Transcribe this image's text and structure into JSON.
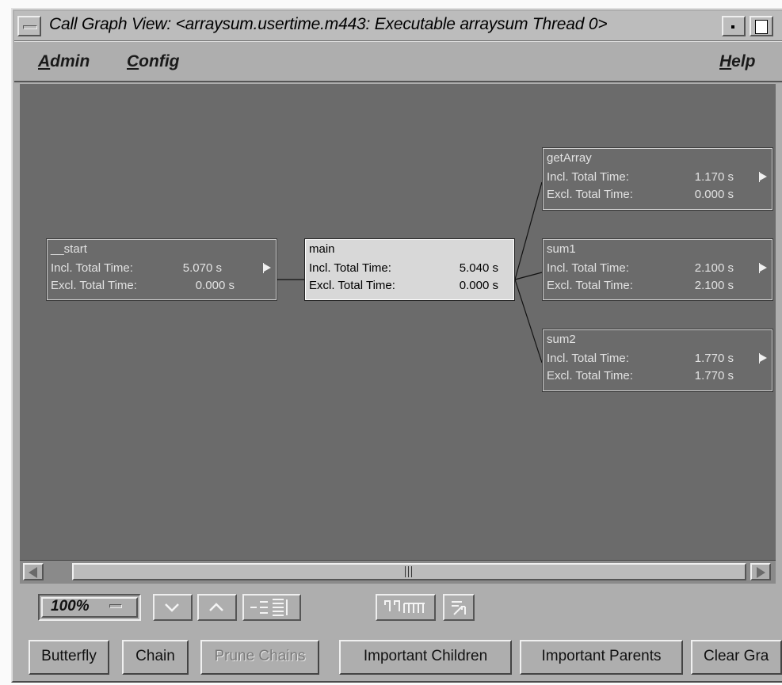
{
  "window": {
    "title": "Call Graph View: <arraysum.usertime.m443: Executable arraysum Thread 0>"
  },
  "menubar": {
    "admin": "Admin",
    "admin_mnemonic": "A",
    "admin_rest": "dmin",
    "config": "Config",
    "config_mnemonic": "C",
    "config_rest": "onfig",
    "help": "Help",
    "help_mnemonic": "H",
    "help_rest": "elp"
  },
  "graph": {
    "incl_label": "Incl. Total Time:",
    "excl_label": "Excl. Total Time:",
    "nodes": [
      {
        "name": "__start",
        "incl": "5.070 s",
        "excl": "0.000 s",
        "selected": false,
        "has_flag": true
      },
      {
        "name": "main",
        "incl": "5.040 s",
        "excl": "0.000 s",
        "selected": true,
        "has_flag": false
      },
      {
        "name": "getArray",
        "incl": "1.170 s",
        "excl": "0.000 s",
        "selected": false,
        "has_flag": true
      },
      {
        "name": "sum1",
        "incl": "2.100 s",
        "excl": "2.100 s",
        "selected": false,
        "has_flag": true
      },
      {
        "name": "sum2",
        "incl": "1.770 s",
        "excl": "1.770 s",
        "selected": false,
        "has_flag": true
      }
    ]
  },
  "toolbar": {
    "zoom_value": "100%",
    "icons": [
      "chevron-down-icon",
      "chevron-up-icon",
      "graph-layout-icon",
      "realign-icon",
      "rotate-icon"
    ]
  },
  "buttons": {
    "butterfly": "Butterfly",
    "chain": "Chain",
    "prune_chains": "Prune Chains",
    "important_children": "Important Children",
    "important_parents": "Important Parents",
    "clear_graph": "Clear Gra"
  },
  "colors": {
    "canvas": "#6b6b6b",
    "chrome": "#aeaeae",
    "selected_node": "#d8d8d8"
  }
}
